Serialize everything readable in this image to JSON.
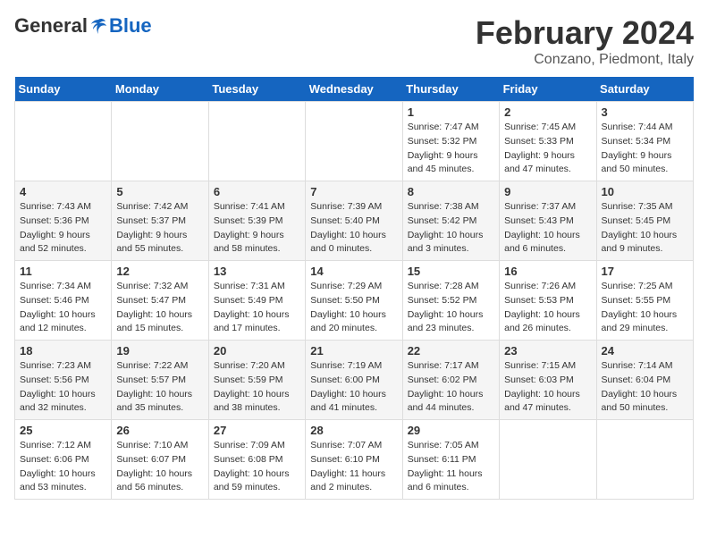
{
  "header": {
    "logo_general": "General",
    "logo_blue": "Blue",
    "title": "February 2024",
    "subtitle": "Conzano, Piedmont, Italy"
  },
  "weekdays": [
    "Sunday",
    "Monday",
    "Tuesday",
    "Wednesday",
    "Thursday",
    "Friday",
    "Saturday"
  ],
  "weeks": [
    [
      {
        "day": "",
        "info": ""
      },
      {
        "day": "",
        "info": ""
      },
      {
        "day": "",
        "info": ""
      },
      {
        "day": "",
        "info": ""
      },
      {
        "day": "1",
        "info": "Sunrise: 7:47 AM\nSunset: 5:32 PM\nDaylight: 9 hours\nand 45 minutes."
      },
      {
        "day": "2",
        "info": "Sunrise: 7:45 AM\nSunset: 5:33 PM\nDaylight: 9 hours\nand 47 minutes."
      },
      {
        "day": "3",
        "info": "Sunrise: 7:44 AM\nSunset: 5:34 PM\nDaylight: 9 hours\nand 50 minutes."
      }
    ],
    [
      {
        "day": "4",
        "info": "Sunrise: 7:43 AM\nSunset: 5:36 PM\nDaylight: 9 hours\nand 52 minutes."
      },
      {
        "day": "5",
        "info": "Sunrise: 7:42 AM\nSunset: 5:37 PM\nDaylight: 9 hours\nand 55 minutes."
      },
      {
        "day": "6",
        "info": "Sunrise: 7:41 AM\nSunset: 5:39 PM\nDaylight: 9 hours\nand 58 minutes."
      },
      {
        "day": "7",
        "info": "Sunrise: 7:39 AM\nSunset: 5:40 PM\nDaylight: 10 hours\nand 0 minutes."
      },
      {
        "day": "8",
        "info": "Sunrise: 7:38 AM\nSunset: 5:42 PM\nDaylight: 10 hours\nand 3 minutes."
      },
      {
        "day": "9",
        "info": "Sunrise: 7:37 AM\nSunset: 5:43 PM\nDaylight: 10 hours\nand 6 minutes."
      },
      {
        "day": "10",
        "info": "Sunrise: 7:35 AM\nSunset: 5:45 PM\nDaylight: 10 hours\nand 9 minutes."
      }
    ],
    [
      {
        "day": "11",
        "info": "Sunrise: 7:34 AM\nSunset: 5:46 PM\nDaylight: 10 hours\nand 12 minutes."
      },
      {
        "day": "12",
        "info": "Sunrise: 7:32 AM\nSunset: 5:47 PM\nDaylight: 10 hours\nand 15 minutes."
      },
      {
        "day": "13",
        "info": "Sunrise: 7:31 AM\nSunset: 5:49 PM\nDaylight: 10 hours\nand 17 minutes."
      },
      {
        "day": "14",
        "info": "Sunrise: 7:29 AM\nSunset: 5:50 PM\nDaylight: 10 hours\nand 20 minutes."
      },
      {
        "day": "15",
        "info": "Sunrise: 7:28 AM\nSunset: 5:52 PM\nDaylight: 10 hours\nand 23 minutes."
      },
      {
        "day": "16",
        "info": "Sunrise: 7:26 AM\nSunset: 5:53 PM\nDaylight: 10 hours\nand 26 minutes."
      },
      {
        "day": "17",
        "info": "Sunrise: 7:25 AM\nSunset: 5:55 PM\nDaylight: 10 hours\nand 29 minutes."
      }
    ],
    [
      {
        "day": "18",
        "info": "Sunrise: 7:23 AM\nSunset: 5:56 PM\nDaylight: 10 hours\nand 32 minutes."
      },
      {
        "day": "19",
        "info": "Sunrise: 7:22 AM\nSunset: 5:57 PM\nDaylight: 10 hours\nand 35 minutes."
      },
      {
        "day": "20",
        "info": "Sunrise: 7:20 AM\nSunset: 5:59 PM\nDaylight: 10 hours\nand 38 minutes."
      },
      {
        "day": "21",
        "info": "Sunrise: 7:19 AM\nSunset: 6:00 PM\nDaylight: 10 hours\nand 41 minutes."
      },
      {
        "day": "22",
        "info": "Sunrise: 7:17 AM\nSunset: 6:02 PM\nDaylight: 10 hours\nand 44 minutes."
      },
      {
        "day": "23",
        "info": "Sunrise: 7:15 AM\nSunset: 6:03 PM\nDaylight: 10 hours\nand 47 minutes."
      },
      {
        "day": "24",
        "info": "Sunrise: 7:14 AM\nSunset: 6:04 PM\nDaylight: 10 hours\nand 50 minutes."
      }
    ],
    [
      {
        "day": "25",
        "info": "Sunrise: 7:12 AM\nSunset: 6:06 PM\nDaylight: 10 hours\nand 53 minutes."
      },
      {
        "day": "26",
        "info": "Sunrise: 7:10 AM\nSunset: 6:07 PM\nDaylight: 10 hours\nand 56 minutes."
      },
      {
        "day": "27",
        "info": "Sunrise: 7:09 AM\nSunset: 6:08 PM\nDaylight: 10 hours\nand 59 minutes."
      },
      {
        "day": "28",
        "info": "Sunrise: 7:07 AM\nSunset: 6:10 PM\nDaylight: 11 hours\nand 2 minutes."
      },
      {
        "day": "29",
        "info": "Sunrise: 7:05 AM\nSunset: 6:11 PM\nDaylight: 11 hours\nand 6 minutes."
      },
      {
        "day": "",
        "info": ""
      },
      {
        "day": "",
        "info": ""
      }
    ]
  ]
}
